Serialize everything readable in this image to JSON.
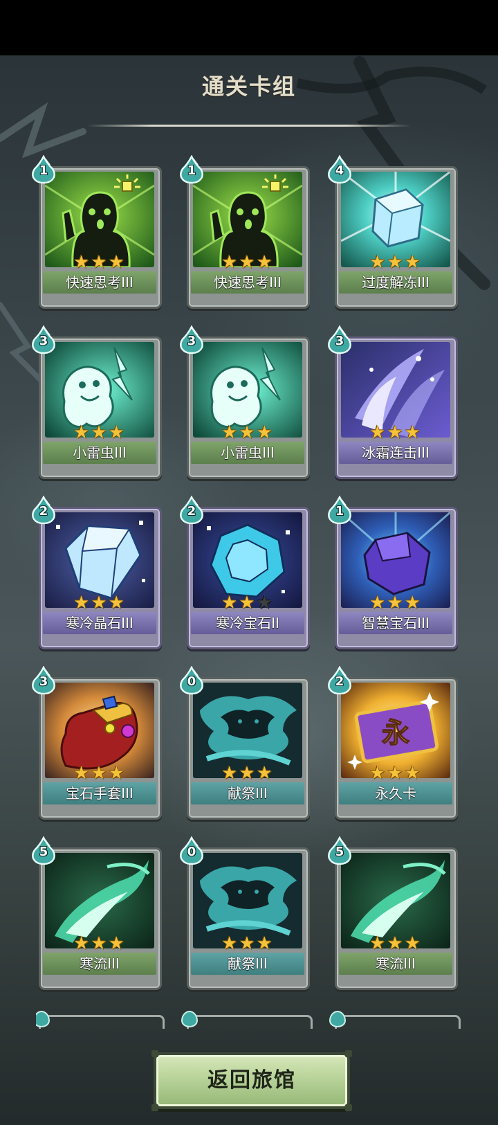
{
  "title": "通关卡组",
  "cards": [
    {
      "name": "快速思考III",
      "cost": "1",
      "stars": 3,
      "max_stars": 3,
      "art": "idea-icon",
      "theme": "green"
    },
    {
      "name": "快速思考III",
      "cost": "1",
      "stars": 3,
      "max_stars": 3,
      "art": "idea-icon",
      "theme": "green"
    },
    {
      "name": "过度解冻III",
      "cost": "4",
      "stars": 3,
      "max_stars": 3,
      "art": "ice-cube-icon",
      "theme": "green"
    },
    {
      "name": "小雷虫III",
      "cost": "3",
      "stars": 3,
      "max_stars": 3,
      "art": "ghost-icon",
      "theme": "green"
    },
    {
      "name": "小雷虫III",
      "cost": "3",
      "stars": 3,
      "max_stars": 3,
      "art": "ghost-icon",
      "theme": "green"
    },
    {
      "name": "冰霜连击III",
      "cost": "3",
      "stars": 3,
      "max_stars": 3,
      "art": "frost-icon",
      "theme": "purple"
    },
    {
      "name": "寒冷晶石III",
      "cost": "2",
      "stars": 3,
      "max_stars": 3,
      "art": "crystal-icon",
      "theme": "purple"
    },
    {
      "name": "寒冷宝石II",
      "cost": "2",
      "stars": 2,
      "max_stars": 3,
      "art": "gem-icon",
      "theme": "purple"
    },
    {
      "name": "智慧宝石III",
      "cost": "1",
      "stars": 3,
      "max_stars": 3,
      "art": "stone-icon",
      "theme": "purple"
    },
    {
      "name": "宝石手套III",
      "cost": "3",
      "stars": 3,
      "max_stars": 3,
      "art": "gauntlet-icon",
      "theme": "teal"
    },
    {
      "name": "献祭III",
      "cost": "0",
      "stars": 3,
      "max_stars": 3,
      "art": "vortex-icon",
      "theme": "teal"
    },
    {
      "name": "永久卡",
      "cost": "2",
      "stars": 3,
      "max_stars": 3,
      "art": "ticket-icon",
      "theme": "teal",
      "art_text": "永"
    },
    {
      "name": "寒流III",
      "cost": "5",
      "stars": 3,
      "max_stars": 3,
      "art": "wave-icon",
      "theme": "green"
    },
    {
      "name": "献祭III",
      "cost": "0",
      "stars": 3,
      "max_stars": 3,
      "art": "vortex-icon",
      "theme": "teal"
    },
    {
      "name": "寒流III",
      "cost": "5",
      "stars": 3,
      "max_stars": 3,
      "art": "wave-icon",
      "theme": "green"
    }
  ],
  "back_button": "返回旅馆",
  "colors": {
    "star": "#f5c23a",
    "cost_drop": "#3fa8a2",
    "title": "#e4ddc8"
  }
}
